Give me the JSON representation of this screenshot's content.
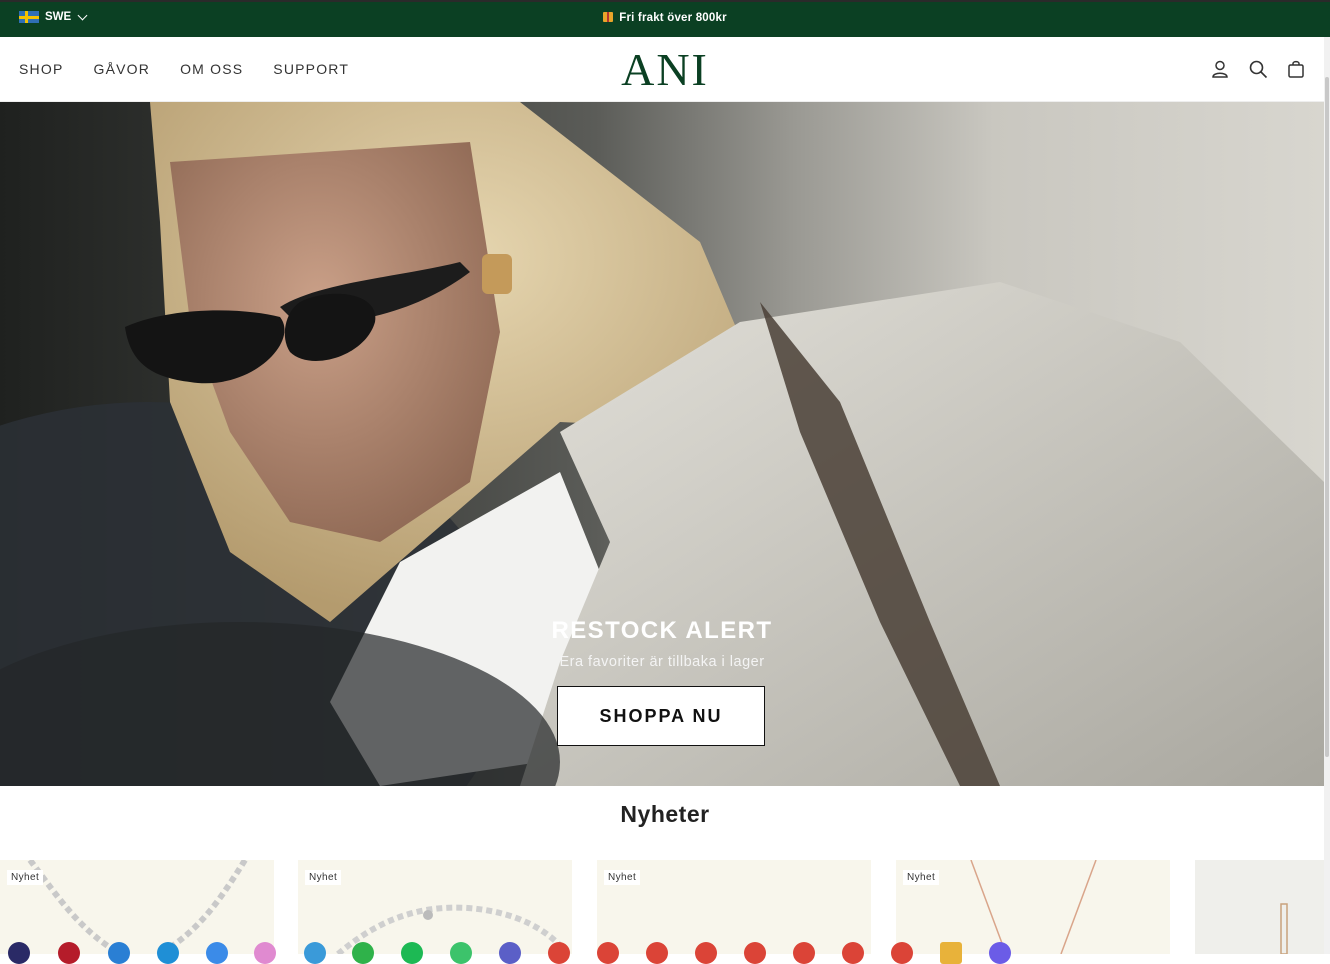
{
  "topbar": {
    "region_label": "SWE",
    "announcement": "Fri frakt över 800kr"
  },
  "header": {
    "logo": "ANI",
    "nav": [
      {
        "label": "SHOP"
      },
      {
        "label": "GÅVOR"
      },
      {
        "label": "OM OSS"
      },
      {
        "label": "SUPPORT"
      }
    ],
    "icons": [
      "account-icon",
      "search-icon",
      "cart-icon"
    ]
  },
  "hero": {
    "title": "RESTOCK ALERT",
    "subtitle": "Era favoriter är tillbaka i lager",
    "button_label": "SHOPPA NU"
  },
  "section": {
    "title": "Nyheter"
  },
  "products": [
    {
      "badge": "Nyhet"
    },
    {
      "badge": "Nyhet"
    },
    {
      "badge": "Nyhet"
    },
    {
      "badge": "Nyhet"
    },
    {
      "badge": ""
    }
  ],
  "colors": {
    "brand_green": "#0b4023",
    "card_bg": "#f8f6ec"
  }
}
